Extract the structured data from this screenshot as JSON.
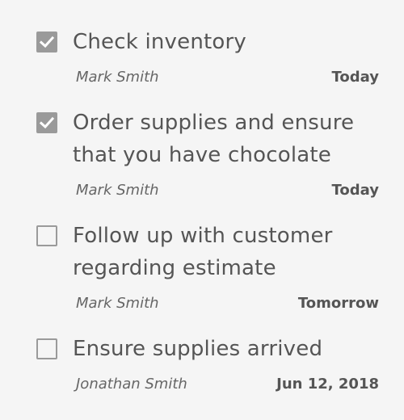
{
  "tasks": [
    {
      "title": "Check inventory",
      "assignee": "Mark Smith",
      "due": "Today",
      "completed": true,
      "checkbox_icon": "checkmark-icon"
    },
    {
      "title": "Order supplies and ensure that you have chocolate",
      "assignee": "Mark Smith",
      "due": "Today",
      "completed": true,
      "checkbox_icon": "checkmark-icon"
    },
    {
      "title": "Follow up with customer regarding estimate",
      "assignee": "Mark Smith",
      "due": "Tomorrow",
      "completed": false,
      "checkbox_icon": "empty-checkbox-icon"
    },
    {
      "title": "Ensure supplies arrived",
      "assignee": "Jonathan Smith",
      "due": "Jun 12, 2018",
      "completed": false,
      "checkbox_icon": "empty-checkbox-icon"
    }
  ],
  "colors": {
    "background": "#f5f5f5",
    "checkbox": "#9a9a9a",
    "text": "#555555"
  }
}
